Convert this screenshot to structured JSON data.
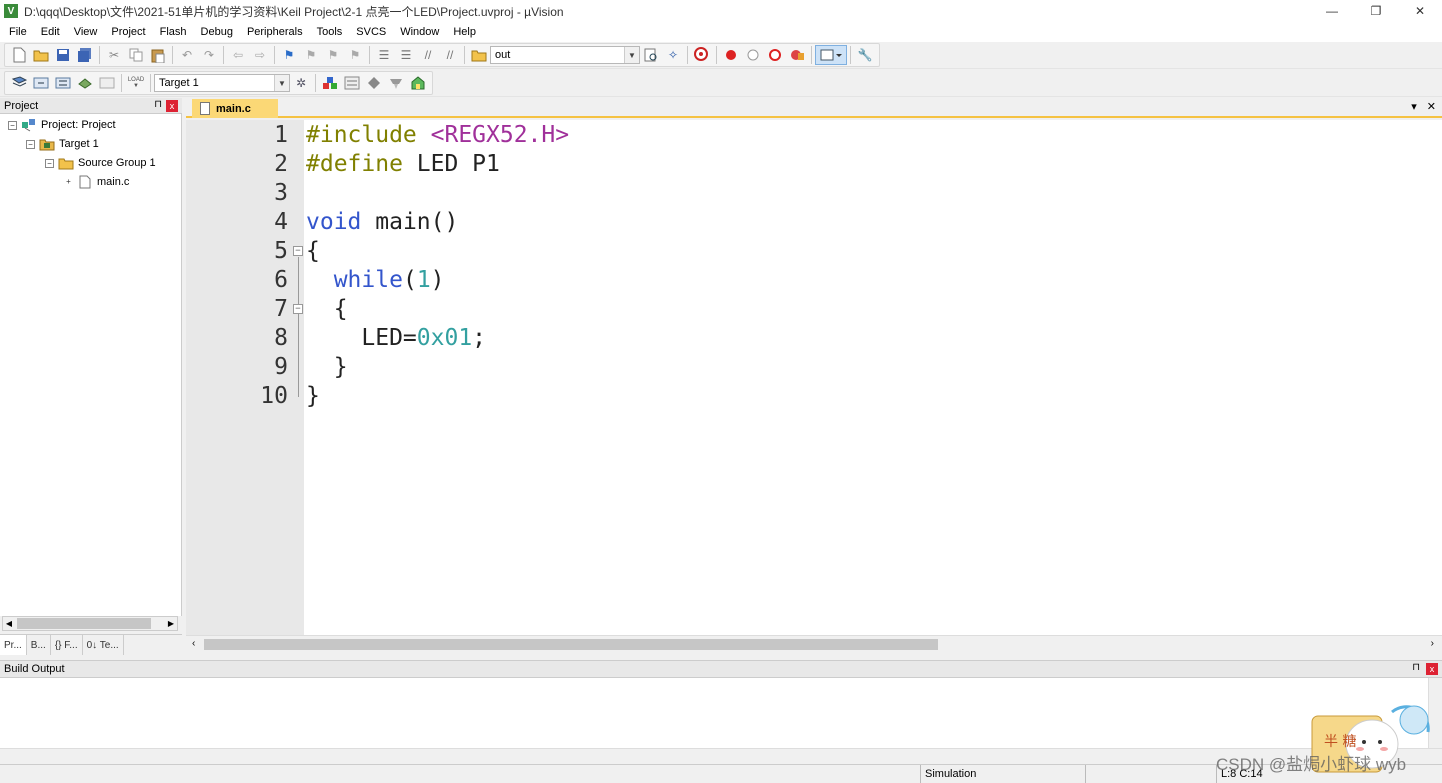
{
  "window": {
    "title": "D:\\qqq\\Desktop\\文件\\2021-51单片机的学习资料\\Keil Project\\2-1 点亮一个LED\\Project.uvproj - µVision",
    "app_icon": "V",
    "minimize": "—",
    "restore": "❐",
    "close": "✕"
  },
  "menu": [
    "File",
    "Edit",
    "View",
    "Project",
    "Flash",
    "Debug",
    "Peripherals",
    "Tools",
    "SVCS",
    "Window",
    "Help"
  ],
  "toolbar1": {
    "find_combo_value": "out"
  },
  "toolbar2": {
    "target_combo_value": "Target 1",
    "load_label": "LOAD"
  },
  "project_panel": {
    "title": "Project",
    "pin": "⊓",
    "close": "x",
    "tree": [
      {
        "label": "Project: Project",
        "expander": "−"
      },
      {
        "label": "Target 1",
        "expander": "−"
      },
      {
        "label": "Source Group 1",
        "expander": "−"
      },
      {
        "label": "main.c",
        "expander": "+"
      }
    ],
    "tabs": [
      "Pr...",
      "B...",
      "{} F...",
      "0↓ Te..."
    ]
  },
  "editor": {
    "tab_label": "main.c",
    "tab_menu": "▾",
    "tab_close": "✕",
    "lines": [
      {
        "num": "1",
        "parts": [
          {
            "c": "pre",
            "t": "#include "
          },
          {
            "c": "hdr",
            "t": "<REGX52.H>"
          }
        ]
      },
      {
        "num": "2",
        "parts": [
          {
            "c": "pre",
            "t": "#define "
          },
          {
            "c": "txt",
            "t": "LED P1"
          }
        ]
      },
      {
        "num": "3",
        "parts": []
      },
      {
        "num": "4",
        "parts": [
          {
            "c": "kw",
            "t": "void "
          },
          {
            "c": "txt",
            "t": "main()"
          }
        ]
      },
      {
        "num": "5",
        "parts": [
          {
            "c": "txt",
            "t": "{"
          }
        ]
      },
      {
        "num": "6",
        "parts": [
          {
            "c": "txt",
            "t": "  "
          },
          {
            "c": "kw",
            "t": "while"
          },
          {
            "c": "txt",
            "t": "("
          },
          {
            "c": "num",
            "t": "1"
          },
          {
            "c": "txt",
            "t": ")"
          }
        ]
      },
      {
        "num": "7",
        "parts": [
          {
            "c": "txt",
            "t": "  {"
          }
        ]
      },
      {
        "num": "8",
        "parts": [
          {
            "c": "txt",
            "t": "    LED="
          },
          {
            "c": "num",
            "t": "0x01"
          },
          {
            "c": "txt",
            "t": ";"
          }
        ]
      },
      {
        "num": "9",
        "parts": [
          {
            "c": "txt",
            "t": "  }"
          }
        ]
      },
      {
        "num": "10",
        "parts": [
          {
            "c": "txt",
            "t": "}"
          }
        ]
      }
    ]
  },
  "build_output": {
    "title": "Build Output"
  },
  "status": {
    "mode": "Simulation",
    "position": "L:8 C:14"
  },
  "watermark": "CSDN @盐焗小虾球 wyb",
  "mascot_text": "半 糖"
}
